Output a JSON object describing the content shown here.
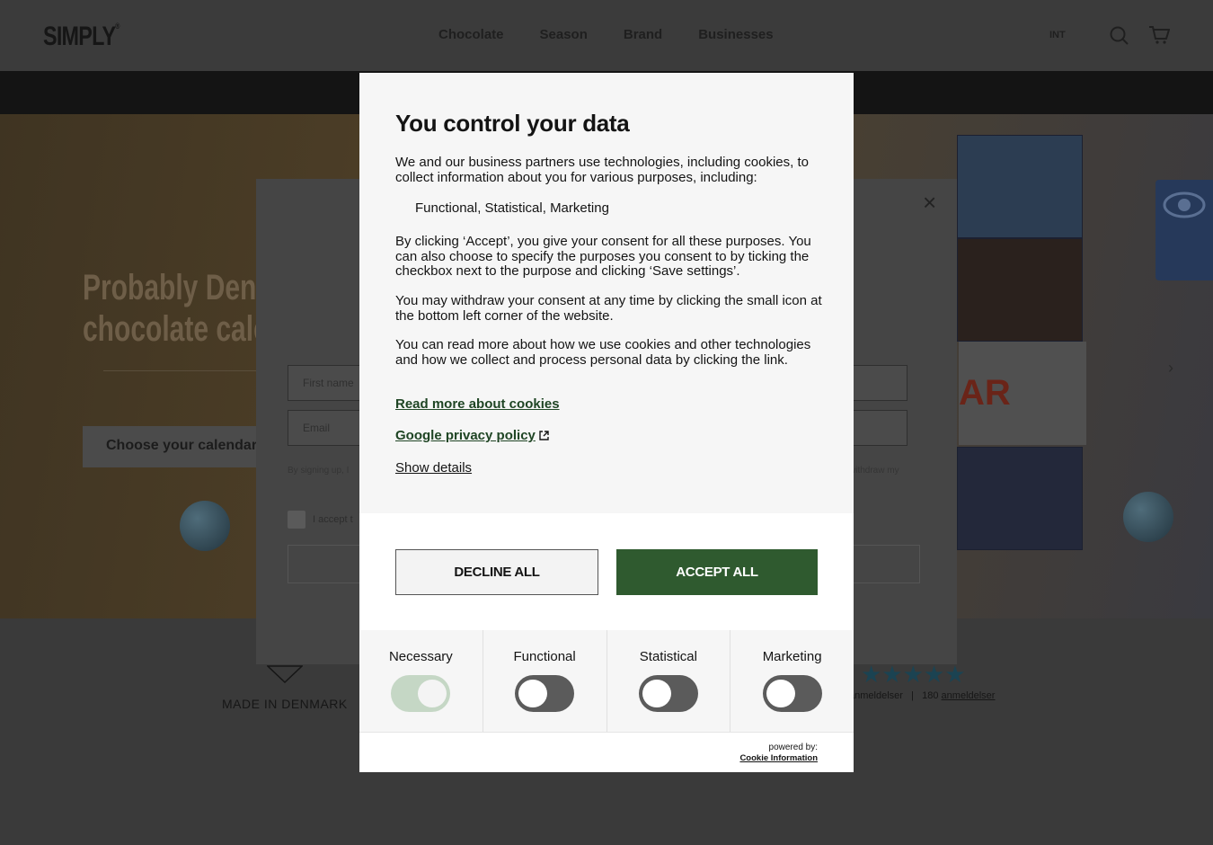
{
  "header": {
    "logo": "SIMPLY",
    "logo_mark": "®",
    "nav": [
      "Chocolate",
      "Season",
      "Brand",
      "Businesses"
    ],
    "lang": "INT"
  },
  "hero": {
    "title_line1": "Probably Denm",
    "title_line2": "chocolate cale",
    "cta": "Choose your calendar",
    "calendar_text": "AR"
  },
  "newsletter": {
    "close": "×",
    "first_name_placeholder": "First name",
    "email_placeholder": "Email",
    "small_left": "By signing up, I",
    "small_right": "withdraw my",
    "accept_label": "I accept t"
  },
  "footer_strip": {
    "made_in": "MADE IN DENMARK",
    "stars": "★★★★★",
    "reviews_left": "anmeldelser",
    "reviews_sep": "|",
    "reviews_count": "180",
    "reviews_link": "anmeldelser"
  },
  "modal": {
    "title": "You control your data",
    "intro": "We and our business partners use technologies, including cookies, to collect information about you for various purposes, including:",
    "purposes": "Functional,  Statistical,  Marketing",
    "consent_text": "By clicking ‘Accept’, you give your consent for all these purposes. You can also choose to specify the purposes you consent to by ticking the checkbox next to the purpose and clicking ‘Save settings’.",
    "withdraw_text": "You may withdraw your consent at any time by clicking the small icon at the bottom left corner of the website.",
    "read_more_text": "You can read more about how we use cookies and other technologies and how we collect and process personal data by clicking the link.",
    "link_cookies": "Read more about cookies",
    "link_google": "Google privacy policy",
    "show_details": "Show details",
    "decline": "DECLINE ALL",
    "accept": "ACCEPT ALL",
    "categories": [
      {
        "label": "Necessary",
        "on": true
      },
      {
        "label": "Functional",
        "on": false
      },
      {
        "label": "Statistical",
        "on": false
      },
      {
        "label": "Marketing",
        "on": false
      }
    ],
    "powered_by": "powered by:",
    "powered_brand": "Cookie Information",
    "accent_color": "#2f5a2f"
  }
}
